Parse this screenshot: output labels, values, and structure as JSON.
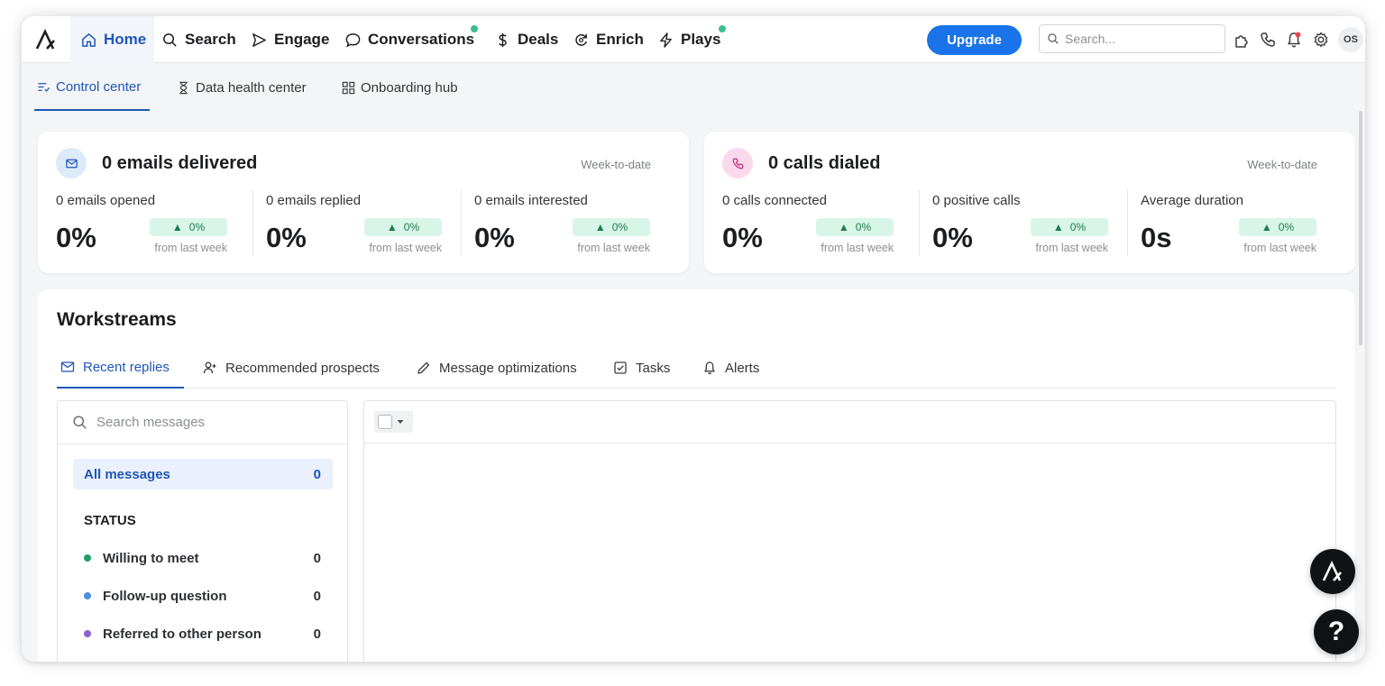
{
  "colors": {
    "accent": "#1f56b8",
    "upgrade_bg": "#1a73e8",
    "green_dot": "#3bbf8a",
    "positive_badge": "#d8f6e7",
    "email_icon_bg": "#dcebf9",
    "call_icon_bg": "#fbd9ec",
    "status_willing": "#22a06b",
    "status_followup": "#4a8fe0",
    "status_referred": "#8a63d2"
  },
  "nav": {
    "items": [
      {
        "label": "Home",
        "icon": "home-icon"
      },
      {
        "label": "Search",
        "icon": "search-icon"
      },
      {
        "label": "Engage",
        "icon": "send-icon"
      },
      {
        "label": "Conversations",
        "icon": "chat-bubble-icon"
      },
      {
        "label": "Deals",
        "icon": "dollar-icon"
      },
      {
        "label": "Enrich",
        "icon": "refresh-icon"
      },
      {
        "label": "Plays",
        "icon": "lightning-icon"
      }
    ],
    "upgrade_label": "Upgrade",
    "search_placeholder": "Search...",
    "avatar_initials": "OS"
  },
  "subnav": {
    "items": [
      {
        "label": "Control center",
        "icon": "list-check-icon"
      },
      {
        "label": "Data health center",
        "icon": "hourglass-icon"
      },
      {
        "label": "Onboarding hub",
        "icon": "grid-icon"
      }
    ]
  },
  "email_card": {
    "title": "0 emails delivered",
    "range": "Week-to-date",
    "metrics": [
      {
        "label": "0 emails opened",
        "value": "0%",
        "change": "0%",
        "sub": "from last week"
      },
      {
        "label": "0 emails replied",
        "value": "0%",
        "change": "0%",
        "sub": "from last week"
      },
      {
        "label": "0 emails interested",
        "value": "0%",
        "change": "0%",
        "sub": "from last week"
      }
    ]
  },
  "call_card": {
    "title": "0 calls dialed",
    "range": "Week-to-date",
    "metrics": [
      {
        "label": "0 calls connected",
        "value": "0%",
        "change": "0%",
        "sub": "from last week"
      },
      {
        "label": "0 positive calls",
        "value": "0%",
        "change": "0%",
        "sub": "from last week"
      },
      {
        "label": "Average duration",
        "value": "0s",
        "change": "0%",
        "sub": "from last week"
      }
    ]
  },
  "workstreams": {
    "title": "Workstreams",
    "tabs": [
      {
        "label": "Recent replies",
        "icon": "mail-icon"
      },
      {
        "label": "Recommended prospects",
        "icon": "person-add-icon"
      },
      {
        "label": "Message optimizations",
        "icon": "pencil-icon"
      },
      {
        "label": "Tasks",
        "icon": "checkbox-icon"
      },
      {
        "label": "Alerts",
        "icon": "bell-icon"
      }
    ],
    "search_placeholder": "Search messages",
    "all_messages": {
      "label": "All messages",
      "count": "0"
    },
    "status_heading": "STATUS",
    "statuses": [
      {
        "label": "Willing to meet",
        "count": "0"
      },
      {
        "label": "Follow-up question",
        "count": "0"
      },
      {
        "label": "Referred to other person",
        "count": "0"
      }
    ]
  },
  "help": {
    "label": "?"
  }
}
